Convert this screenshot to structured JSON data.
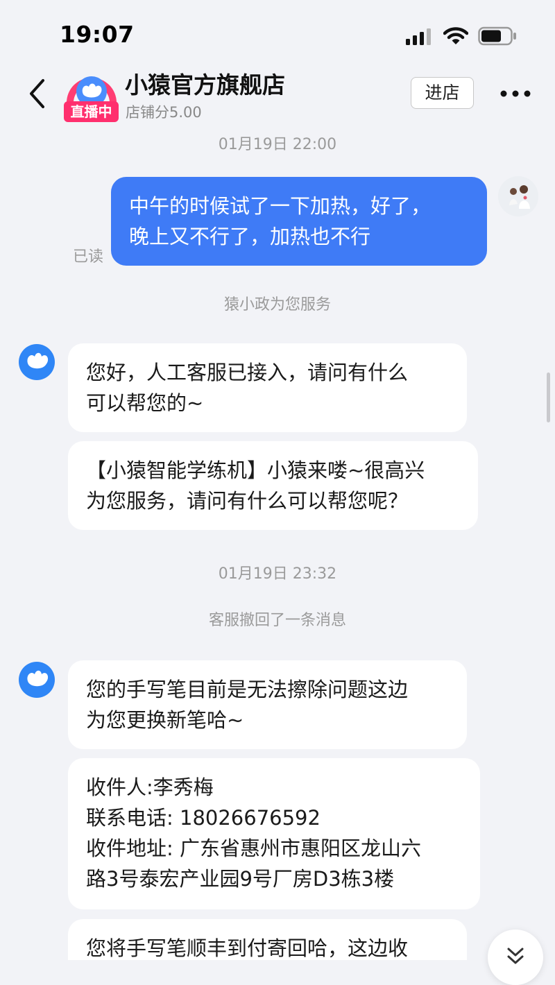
{
  "status_bar": {
    "time": "19:07",
    "icons": [
      "signal-icon",
      "wifi-icon",
      "battery-icon"
    ]
  },
  "header": {
    "back_icon": "chevron-left-icon",
    "shop_name": "小猿官方旗舰店",
    "live_badge": "直播中",
    "score": "店铺分5.00",
    "enter_button": "进店",
    "more_icon": "more-dots-icon"
  },
  "chat": {
    "timestamp_1": "01月19日 22:00",
    "user_message": {
      "lines": [
        "中午的时候试了一下加热，好了，",
        "晚上又不行了，加热也不行"
      ],
      "read_status": "已读"
    },
    "system_notice_1": "猿小政为您服务",
    "agent_messages_1": [
      {
        "lines": [
          "您好，人工客服已接入，请问有什么",
          "可以帮您的~"
        ]
      },
      {
        "lines": [
          "【小猿智能学练机】小猿来喽~很高兴",
          "为您服务，请问有什么可以帮您呢？"
        ]
      }
    ],
    "timestamp_2": "01月19日 23:32",
    "system_notice_2": "客服撤回了一条消息",
    "agent_messages_2": [
      {
        "lines": [
          "您的手写笔目前是无法擦除问题这边",
          "为您更换新笔哈~"
        ]
      },
      {
        "lines": [
          "收件人:李秀梅",
          "联系电话: 18026676592",
          "收件地址: 广东省惠州市惠阳区龙山六",
          "路3号泰宏产业园9号厂房D3栋3楼"
        ]
      },
      {
        "lines": [
          "您将手写笔顺丰到付寄回哈，这边收"
        ]
      }
    ]
  },
  "colors": {
    "accent_blue": "#3f7bf6",
    "live_badge_pink": "#ff2f6e",
    "background": "#f2f3f7"
  }
}
